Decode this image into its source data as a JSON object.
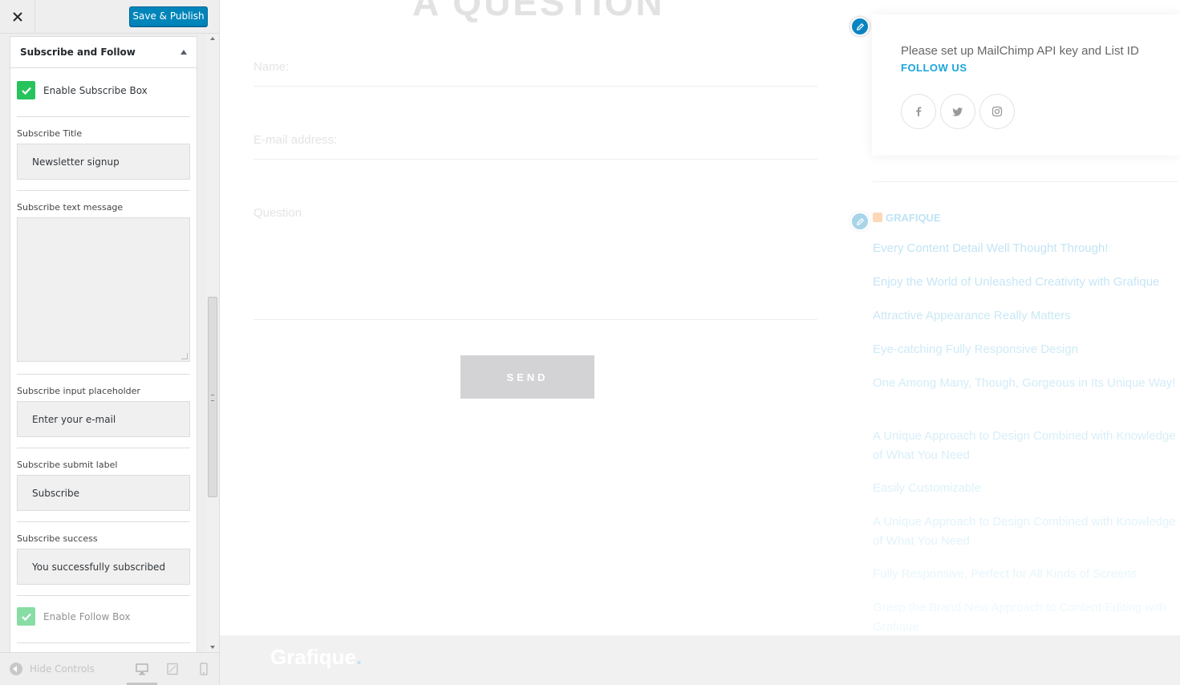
{
  "sidebar": {
    "publish_label": "Save & Publish",
    "section_title": "Subscribe and Follow",
    "enable_subscribe_label": "Enable Subscribe Box",
    "subscribe_title_label": "Subscribe Title",
    "subscribe_title_value": "Newsletter signup",
    "subscribe_text_label": "Subscribe text message",
    "subscribe_text_value": "",
    "placeholder_label": "Subscribe input placeholder",
    "placeholder_value": "Enter your e-mail",
    "submit_label": "Subscribe submit label",
    "submit_value": "Subscribe",
    "success_label": "Subscribe success",
    "success_value": "You successfully subscribed",
    "enable_follow_label": "Enable Follow Box",
    "hide_controls_label": "Hide Controls"
  },
  "preview": {
    "heading": "A QUESTION",
    "form": {
      "name_placeholder": "Name:",
      "email_placeholder": "E-mail address:",
      "question_placeholder": "Question",
      "send_label": "SEND"
    },
    "widget": {
      "mailchimp_text": "Please set up MailChimp API key and List ID",
      "follow_title": "FOLLOW US",
      "social_icons": [
        "facebook-icon",
        "twitter-icon",
        "instagram-icon"
      ]
    },
    "rss": {
      "title": "GRAFIQUE",
      "posts": [
        "Every Content Detail Well Thought Through!",
        "Enjoy the World of Unleashed Creativity with Grafique",
        "Attractive Appearance Really Matters",
        "Eye-catching Fully Responsive Design",
        "One Among Many, Though, Gorgeous in Its Unique Way!",
        "A Unique Approach to Design Combined with Knowledge of What You Need",
        "Easily Customizable",
        "A Unique Approach to Design Combined with Knowledge of What You Need",
        "Fully Responsive, Perfect for All Kinds of Screens",
        "Grasp the Brand New Approach to Content Editing with Grafique"
      ]
    },
    "footer_logo": "Grafique",
    "footer_logo_dot": "."
  },
  "colors": {
    "publish": "#0085ba",
    "checkbox": "#27c35c",
    "accent": "#1ba5dc",
    "edit_pencil": "#0a85c1"
  }
}
